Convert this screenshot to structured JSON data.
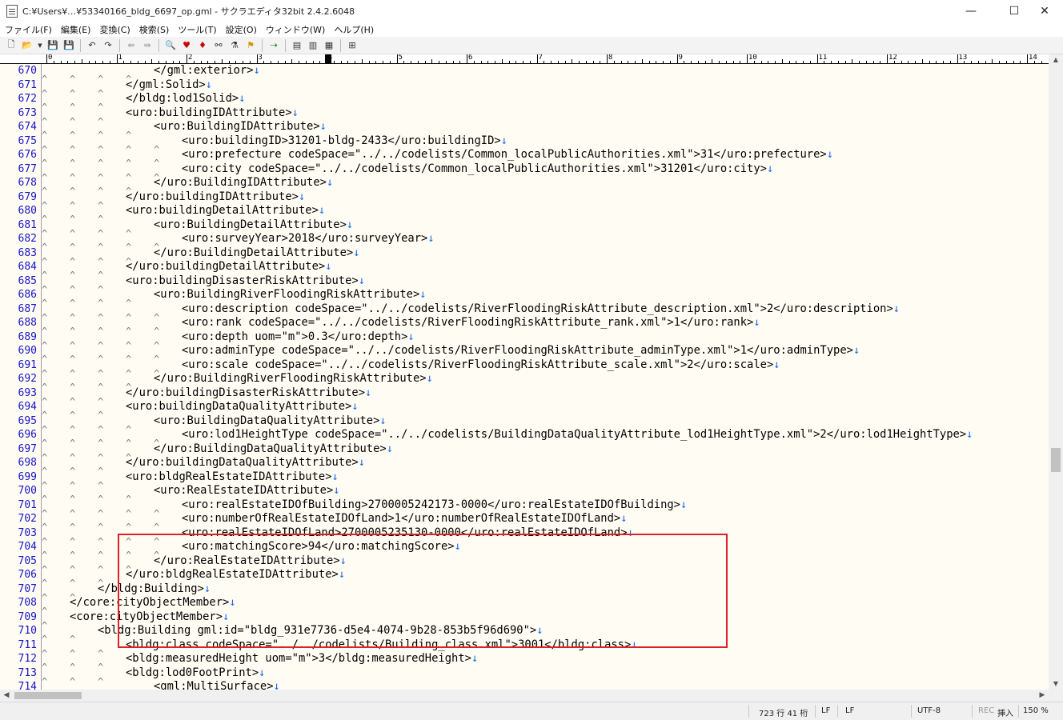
{
  "window": {
    "title": "C:¥Users¥…¥53340166_bldg_6697_op.gml - サクラエディタ32bit 2.4.2.6048",
    "minimize": "—",
    "maximize": "☐",
    "close": "✕"
  },
  "menu": [
    "ファイル(F)",
    "編集(E)",
    "変換(C)",
    "検索(S)",
    "ツール(T)",
    "設定(O)",
    "ウィンドウ(W)",
    "ヘルプ(H)"
  ],
  "toolbar": {
    "icons": [
      "new-file-icon",
      "open-file-icon",
      "dropdown-icon",
      "save-icon",
      "save-all-icon",
      "undo-icon",
      "redo-icon",
      "jump-prev-icon",
      "jump-next-icon",
      "search-icon",
      "search-prev-icon",
      "search-next-icon",
      "replace-icon",
      "grep-icon",
      "bookmark-icon",
      "outline-icon",
      "compare-icon",
      "tag-jump-icon",
      "settings-icon"
    ]
  },
  "ruler": {
    "labels": [
      "0",
      "1",
      "2",
      "3",
      "4",
      "5",
      "6",
      "7",
      "8",
      "9",
      "10",
      "11",
      "12",
      "13",
      "14"
    ]
  },
  "editor": {
    "lines": [
      {
        "num": "670",
        "depth": 4,
        "text": "</gml:exterior>"
      },
      {
        "num": "671",
        "depth": 3,
        "text": "</gml:Solid>"
      },
      {
        "num": "672",
        "depth": 3,
        "text": "</bldg:lod1Solid>"
      },
      {
        "num": "673",
        "depth": 3,
        "text": "<uro:buildingIDAttribute>"
      },
      {
        "num": "674",
        "depth": 4,
        "text": "<uro:BuildingIDAttribute>"
      },
      {
        "num": "675",
        "depth": 5,
        "text": "<uro:buildingID>31201-bldg-2433</uro:buildingID>"
      },
      {
        "num": "676",
        "depth": 5,
        "text": "<uro:prefecture codeSpace=\"../../codelists/Common_localPublicAuthorities.xml\">31</uro:prefecture>"
      },
      {
        "num": "677",
        "depth": 5,
        "text": "<uro:city codeSpace=\"../../codelists/Common_localPublicAuthorities.xml\">31201</uro:city>"
      },
      {
        "num": "678",
        "depth": 4,
        "text": "</uro:BuildingIDAttribute>"
      },
      {
        "num": "679",
        "depth": 3,
        "text": "</uro:buildingIDAttribute>"
      },
      {
        "num": "680",
        "depth": 3,
        "text": "<uro:buildingDetailAttribute>"
      },
      {
        "num": "681",
        "depth": 4,
        "text": "<uro:BuildingDetailAttribute>"
      },
      {
        "num": "682",
        "depth": 5,
        "text": "<uro:surveyYear>2018</uro:surveyYear>"
      },
      {
        "num": "683",
        "depth": 4,
        "text": "</uro:BuildingDetailAttribute>"
      },
      {
        "num": "684",
        "depth": 3,
        "text": "</uro:buildingDetailAttribute>"
      },
      {
        "num": "685",
        "depth": 3,
        "text": "<uro:buildingDisasterRiskAttribute>"
      },
      {
        "num": "686",
        "depth": 4,
        "text": "<uro:BuildingRiverFloodingRiskAttribute>"
      },
      {
        "num": "687",
        "depth": 5,
        "text": "<uro:description codeSpace=\"../../codelists/RiverFloodingRiskAttribute_description.xml\">2</uro:description>"
      },
      {
        "num": "688",
        "depth": 5,
        "text": "<uro:rank codeSpace=\"../../codelists/RiverFloodingRiskAttribute_rank.xml\">1</uro:rank>"
      },
      {
        "num": "689",
        "depth": 5,
        "text": "<uro:depth uom=\"m\">0.3</uro:depth>"
      },
      {
        "num": "690",
        "depth": 5,
        "text": "<uro:adminType codeSpace=\"../../codelists/RiverFloodingRiskAttribute_adminType.xml\">1</uro:adminType>"
      },
      {
        "num": "691",
        "depth": 5,
        "text": "<uro:scale codeSpace=\"../../codelists/RiverFloodingRiskAttribute_scale.xml\">2</uro:scale>"
      },
      {
        "num": "692",
        "depth": 4,
        "text": "</uro:BuildingRiverFloodingRiskAttribute>"
      },
      {
        "num": "693",
        "depth": 3,
        "text": "</uro:buildingDisasterRiskAttribute>"
      },
      {
        "num": "694",
        "depth": 3,
        "text": "<uro:buildingDataQualityAttribute>"
      },
      {
        "num": "695",
        "depth": 4,
        "text": "<uro:BuildingDataQualityAttribute>"
      },
      {
        "num": "696",
        "depth": 5,
        "text": "<uro:lod1HeightType codeSpace=\"../../codelists/BuildingDataQualityAttribute_lod1HeightType.xml\">2</uro:lod1HeightType>"
      },
      {
        "num": "697",
        "depth": 4,
        "text": "</uro:BuildingDataQualityAttribute>"
      },
      {
        "num": "698",
        "depth": 3,
        "text": "</uro:buildingDataQualityAttribute>"
      },
      {
        "num": "699",
        "depth": 3,
        "text": "<uro:bldgRealEstateIDAttribute>"
      },
      {
        "num": "700",
        "depth": 4,
        "text": "<uro:RealEstateIDAttribute>"
      },
      {
        "num": "701",
        "depth": 5,
        "text": "<uro:realEstateIDOfBuilding>2700005242173-0000</uro:realEstateIDOfBuilding>"
      },
      {
        "num": "702",
        "depth": 5,
        "text": "<uro:numberOfRealEstateIDOfLand>1</uro:numberOfRealEstateIDOfLand>"
      },
      {
        "num": "703",
        "depth": 5,
        "text": "<uro:realEstateIDOfLand>2700005235130-0000</uro:realEstateIDOfLand>"
      },
      {
        "num": "704",
        "depth": 5,
        "text": "<uro:matchingScore>94</uro:matchingScore>"
      },
      {
        "num": "705",
        "depth": 4,
        "text": "</uro:RealEstateIDAttribute>"
      },
      {
        "num": "706",
        "depth": 3,
        "text": "</uro:bldgRealEstateIDAttribute>"
      },
      {
        "num": "707",
        "depth": 2,
        "text": "</bldg:Building>"
      },
      {
        "num": "708",
        "depth": 1,
        "text": "</core:cityObjectMember>"
      },
      {
        "num": "709",
        "depth": 1,
        "text": "<core:cityObjectMember>"
      },
      {
        "num": "710",
        "depth": 2,
        "text": "<bldg:Building gml:id=\"bldg_931e7736-d5e4-4074-9b28-853b5f96d690\">"
      },
      {
        "num": "711",
        "depth": 3,
        "text": "<bldg:class codeSpace=\"../../codelists/Building_class.xml\">3001</bldg:class>"
      },
      {
        "num": "712",
        "depth": 3,
        "text": "<bldg:measuredHeight uom=\"m\">3</bldg:measuredHeight>"
      },
      {
        "num": "713",
        "depth": 3,
        "text": "<bldg:lod0FootPrint>"
      },
      {
        "num": "714",
        "depth": 4,
        "text": "<gml:MultiSurface>"
      }
    ],
    "eol_marker": "↓"
  },
  "status": {
    "position": "723 行  41 桁",
    "eol1": "LF",
    "eol2": "LF",
    "encoding": "UTF-8",
    "rec": "REC",
    "insert": "挿入",
    "zoom": "150 %"
  },
  "colors": {
    "highlight_box": "#e01f26",
    "line_number": "#1515c8",
    "editor_bg": "#fffdf3",
    "eol_marker": "#1a6ae8"
  }
}
